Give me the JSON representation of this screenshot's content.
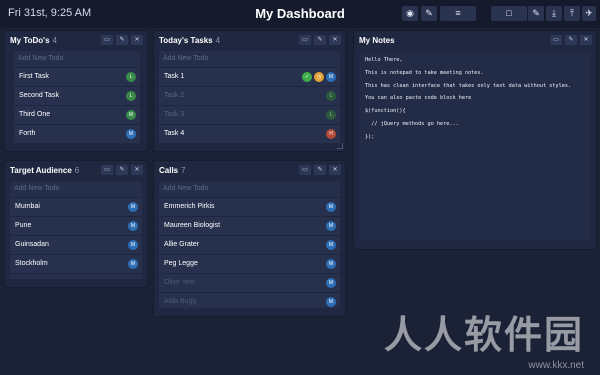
{
  "header": {
    "datetime": "Fri 31st, 9:25 AM",
    "title": "My Dashboard",
    "toolbar": [
      {
        "name": "eye-icon",
        "glyph": "◉"
      },
      {
        "name": "brush-icon",
        "glyph": "✎"
      },
      {
        "name": "list-icon",
        "glyph": "≡"
      },
      {
        "name": "note-icon",
        "glyph": "□"
      },
      {
        "name": "pencil-icon",
        "glyph": "✎"
      },
      {
        "name": "download-icon",
        "glyph": "⤓"
      },
      {
        "name": "upload-icon",
        "glyph": "⤒"
      },
      {
        "name": "bird-icon",
        "glyph": "✈"
      }
    ]
  },
  "panels": {
    "todos": {
      "title": "My ToDo's",
      "count": "4",
      "placeholder": "Add New Todo",
      "items": [
        {
          "label": "First Task",
          "badge": "L"
        },
        {
          "label": "Second Task",
          "badge": "L"
        },
        {
          "label": "Third One",
          "badge": "M"
        },
        {
          "label": "Forth",
          "badge": "M"
        }
      ]
    },
    "today": {
      "title": "Today's Tasks",
      "count": "4",
      "placeholder": "Add New Todo",
      "items": [
        {
          "label": "Task 1",
          "badge": "M"
        },
        {
          "label": "Task 2",
          "badge": "L"
        },
        {
          "label": "Task 3",
          "badge": "L"
        },
        {
          "label": "Task 4",
          "badge": "H"
        }
      ]
    },
    "notes": {
      "title": "My Notes",
      "lines": [
        "Hello There,",
        "This is notepad to take meeting notes.",
        "This has clean interface that takes only text data without styles.",
        "You can also paste code block here",
        "$(function(){",
        "  // jQuery methods go here...",
        "});"
      ]
    },
    "audience": {
      "title": "Target Audience",
      "count": "6",
      "placeholder": "Add New Todo",
      "items": [
        {
          "label": "Mumbai",
          "badge": "M"
        },
        {
          "label": "Pune",
          "badge": "M"
        },
        {
          "label": "Guinsadan",
          "badge": "M"
        },
        {
          "label": "Stockholm",
          "badge": "M"
        }
      ]
    },
    "calls": {
      "title": "Calls",
      "count": "7",
      "placeholder": "Add New Todo",
      "items": [
        {
          "label": "Emmerich Pirkis",
          "badge": "M"
        },
        {
          "label": "Maureen Biologist",
          "badge": "M"
        },
        {
          "label": "Allie Grater",
          "badge": "M"
        },
        {
          "label": "Peg Legge",
          "badge": "M"
        },
        {
          "label": "Olive Yew",
          "badge": "M"
        },
        {
          "label": "Aida Bugg",
          "badge": "M"
        }
      ]
    }
  },
  "watermark": {
    "text": "人人软件园",
    "url": "www.kkx.net"
  },
  "colors": {
    "badge_low": "#3a8a4a",
    "badge_med": "#2e6fb5",
    "badge_high": "#b24a3a",
    "check_green": "#3fae4a",
    "check_orange": "#e3a233"
  }
}
